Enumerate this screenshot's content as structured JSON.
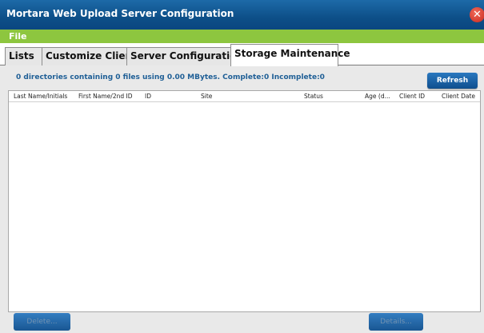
{
  "window": {
    "title": "Mortara Web Upload Server Configuration",
    "close_glyph": "✕"
  },
  "menu": {
    "file_label": "File"
  },
  "tabs": [
    {
      "label": "Lists"
    },
    {
      "label": "Customize Client"
    },
    {
      "label": "Server Configuration"
    },
    {
      "label": "Storage Maintenance",
      "active": true
    }
  ],
  "storage": {
    "summary": "0 directories containing 0 files using 0.00 MBytes. Complete:0 Incomplete:0",
    "refresh_label": "Refresh",
    "columns": [
      "Last Name/Initials",
      "First Name/2nd ID",
      "ID",
      "Site",
      "Status",
      "Age (d...",
      "Client ID",
      "Client Date"
    ],
    "rows": [],
    "delete_label": "Delete...",
    "details_label": "Details..."
  },
  "colors": {
    "title_bar": "#0d4f88",
    "menu_bar": "#8dc63f",
    "accent_text": "#1f5f96",
    "button": "#1a63a7",
    "close": "#d9382b"
  }
}
